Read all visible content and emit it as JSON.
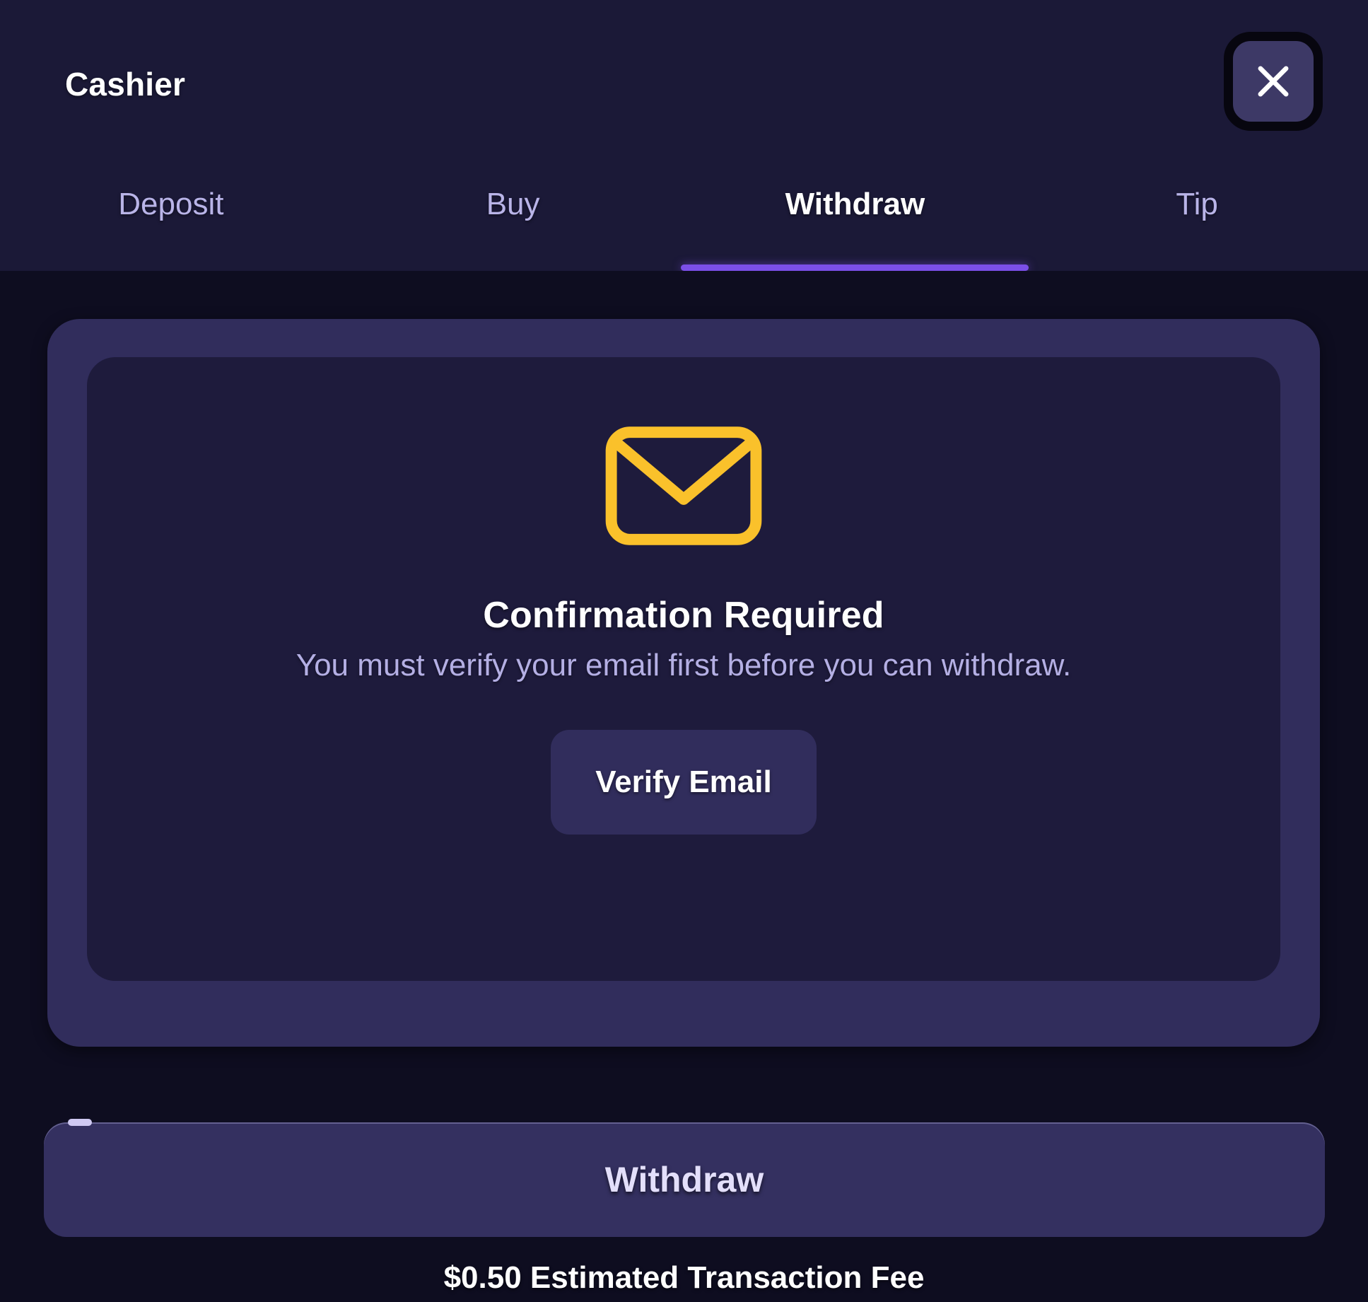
{
  "header": {
    "title": "Cashier",
    "close_icon": "close-icon",
    "close_label": "Close"
  },
  "tabs": [
    {
      "id": "deposit",
      "label": "Deposit",
      "active": false
    },
    {
      "id": "buy",
      "label": "Buy",
      "active": false
    },
    {
      "id": "withdraw",
      "label": "Withdraw",
      "active": true
    },
    {
      "id": "tip",
      "label": "Tip",
      "active": false
    }
  ],
  "panel": {
    "icon": "envelope-icon",
    "title": "Confirmation Required",
    "subtitle": "You must verify your email first before you can withdraw.",
    "verify_button_label": "Verify Email"
  },
  "footer": {
    "withdraw_button_label": "Withdraw",
    "fee_note": "$0.50 Estimated Transaction Fee"
  },
  "colors": {
    "page_background": "#0d0c1e",
    "header_background": "#1b1937",
    "body_background": "#0e0d20",
    "outer_card": "#312d5c",
    "inner_card": "#1e1b3c",
    "accent_purple": "#7b4fe8",
    "envelope_yellow": "#fac12b",
    "text_primary": "#ffffff",
    "text_muted": "#b4afe4"
  }
}
